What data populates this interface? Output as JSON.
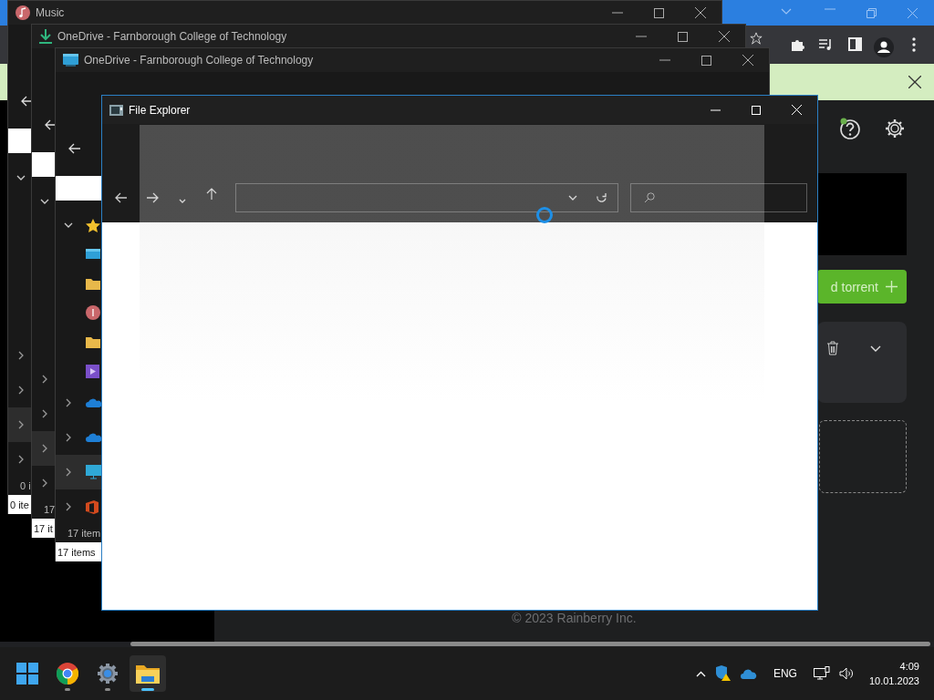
{
  "windows": [
    {
      "kind": "music",
      "title": "Music",
      "sidebar_status": "0 i",
      "status": "0 ite"
    },
    {
      "kind": "download",
      "title": "OneDrive - Farnborough College of Technology",
      "sidebar_status": "17",
      "status": "17 it"
    },
    {
      "kind": "explorer",
      "title": "OneDrive - Farnborough College of Technology",
      "sidebar_status": "17 item",
      "status": "17 items"
    }
  ],
  "explorer": {
    "title": "File Explorer",
    "loading": true
  },
  "web_app": {
    "add_button": "d torrent",
    "footer": "© 2023 Rainberry Inc."
  },
  "taskbar": {
    "apps": [
      {
        "kind": "start",
        "selected": false
      },
      {
        "kind": "chrome",
        "selected": false
      },
      {
        "kind": "settings",
        "selected": false
      },
      {
        "kind": "folder",
        "selected": true
      }
    ],
    "language": "ENG",
    "time": "4:09",
    "date": "10.01.2023"
  }
}
